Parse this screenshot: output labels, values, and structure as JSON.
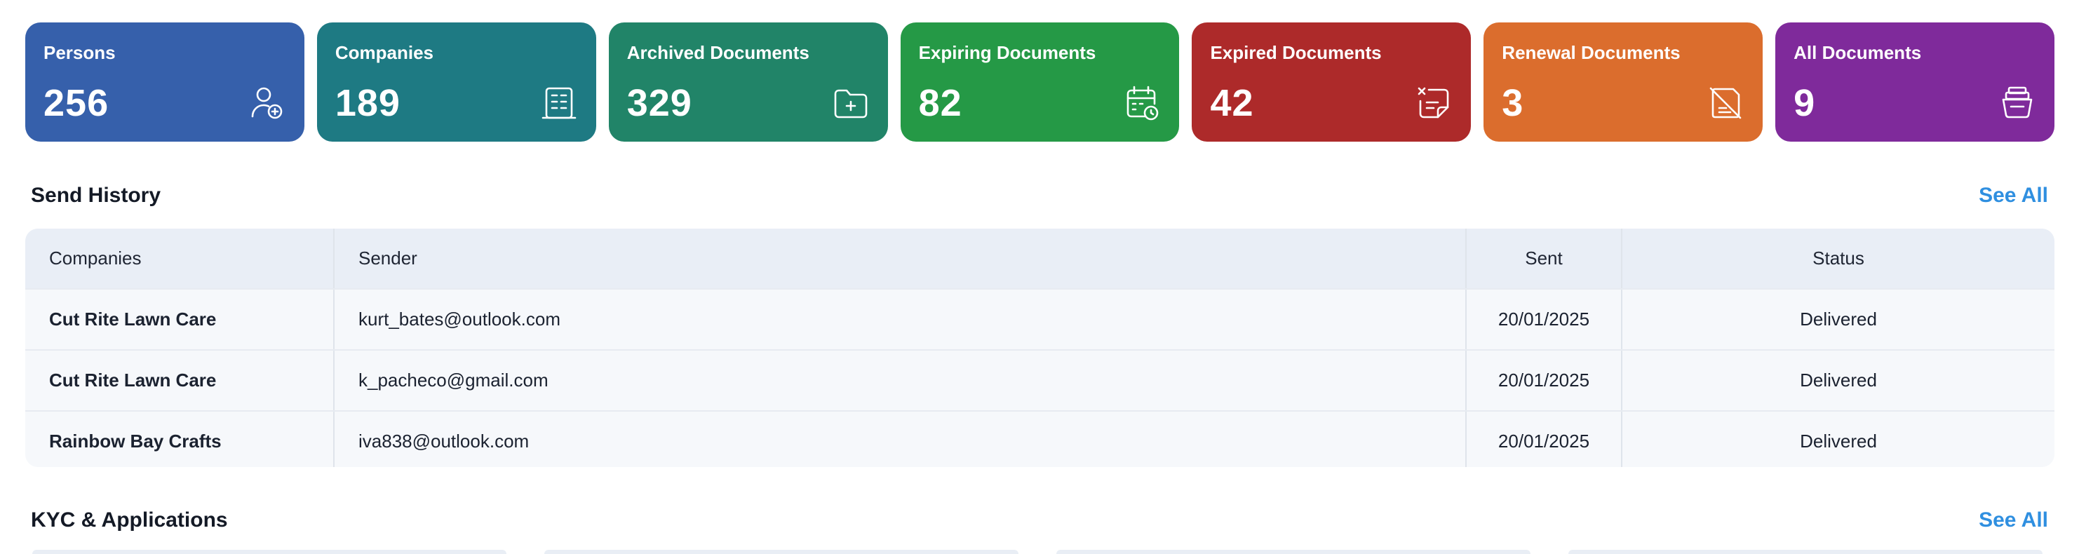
{
  "cards": [
    {
      "label": "Persons",
      "count": "256",
      "color": "#3660ab",
      "icon": "add-person-icon"
    },
    {
      "label": "Companies",
      "count": "189",
      "color": "#1e7a83",
      "icon": "building-icon"
    },
    {
      "label": "Archived Documents",
      "count": "329",
      "color": "#218468",
      "icon": "folder-add-icon"
    },
    {
      "label": "Expiring Documents",
      "count": "82",
      "color": "#259946",
      "icon": "calendar-clock-icon"
    },
    {
      "label": "Expired Documents",
      "count": "42",
      "color": "#ad2a2a",
      "icon": "document-x-icon"
    },
    {
      "label": "Renewal Documents",
      "count": "3",
      "color": "#db6d2d",
      "icon": "document-slash-icon"
    },
    {
      "label": "All Documents",
      "count": "9",
      "color": "#7f2a9b",
      "icon": "document-stack-icon"
    }
  ],
  "send_history": {
    "title": "Send History",
    "see_all": "See All",
    "columns": [
      "Companies",
      "Sender",
      "Sent",
      "Status"
    ],
    "rows": [
      [
        "Cut Rite Lawn Care",
        "kurt_bates@outlook.com",
        "20/01/2025",
        "Delivered"
      ],
      [
        "Cut Rite Lawn Care",
        "k_pacheco@gmail.com",
        "20/01/2025",
        "Delivered"
      ],
      [
        "Rainbow Bay Crafts",
        "iva838@outlook.com",
        "20/01/2025",
        "Delivered"
      ]
    ]
  },
  "kyc": {
    "title": "KYC  & Applications",
    "see_all": "See All"
  }
}
